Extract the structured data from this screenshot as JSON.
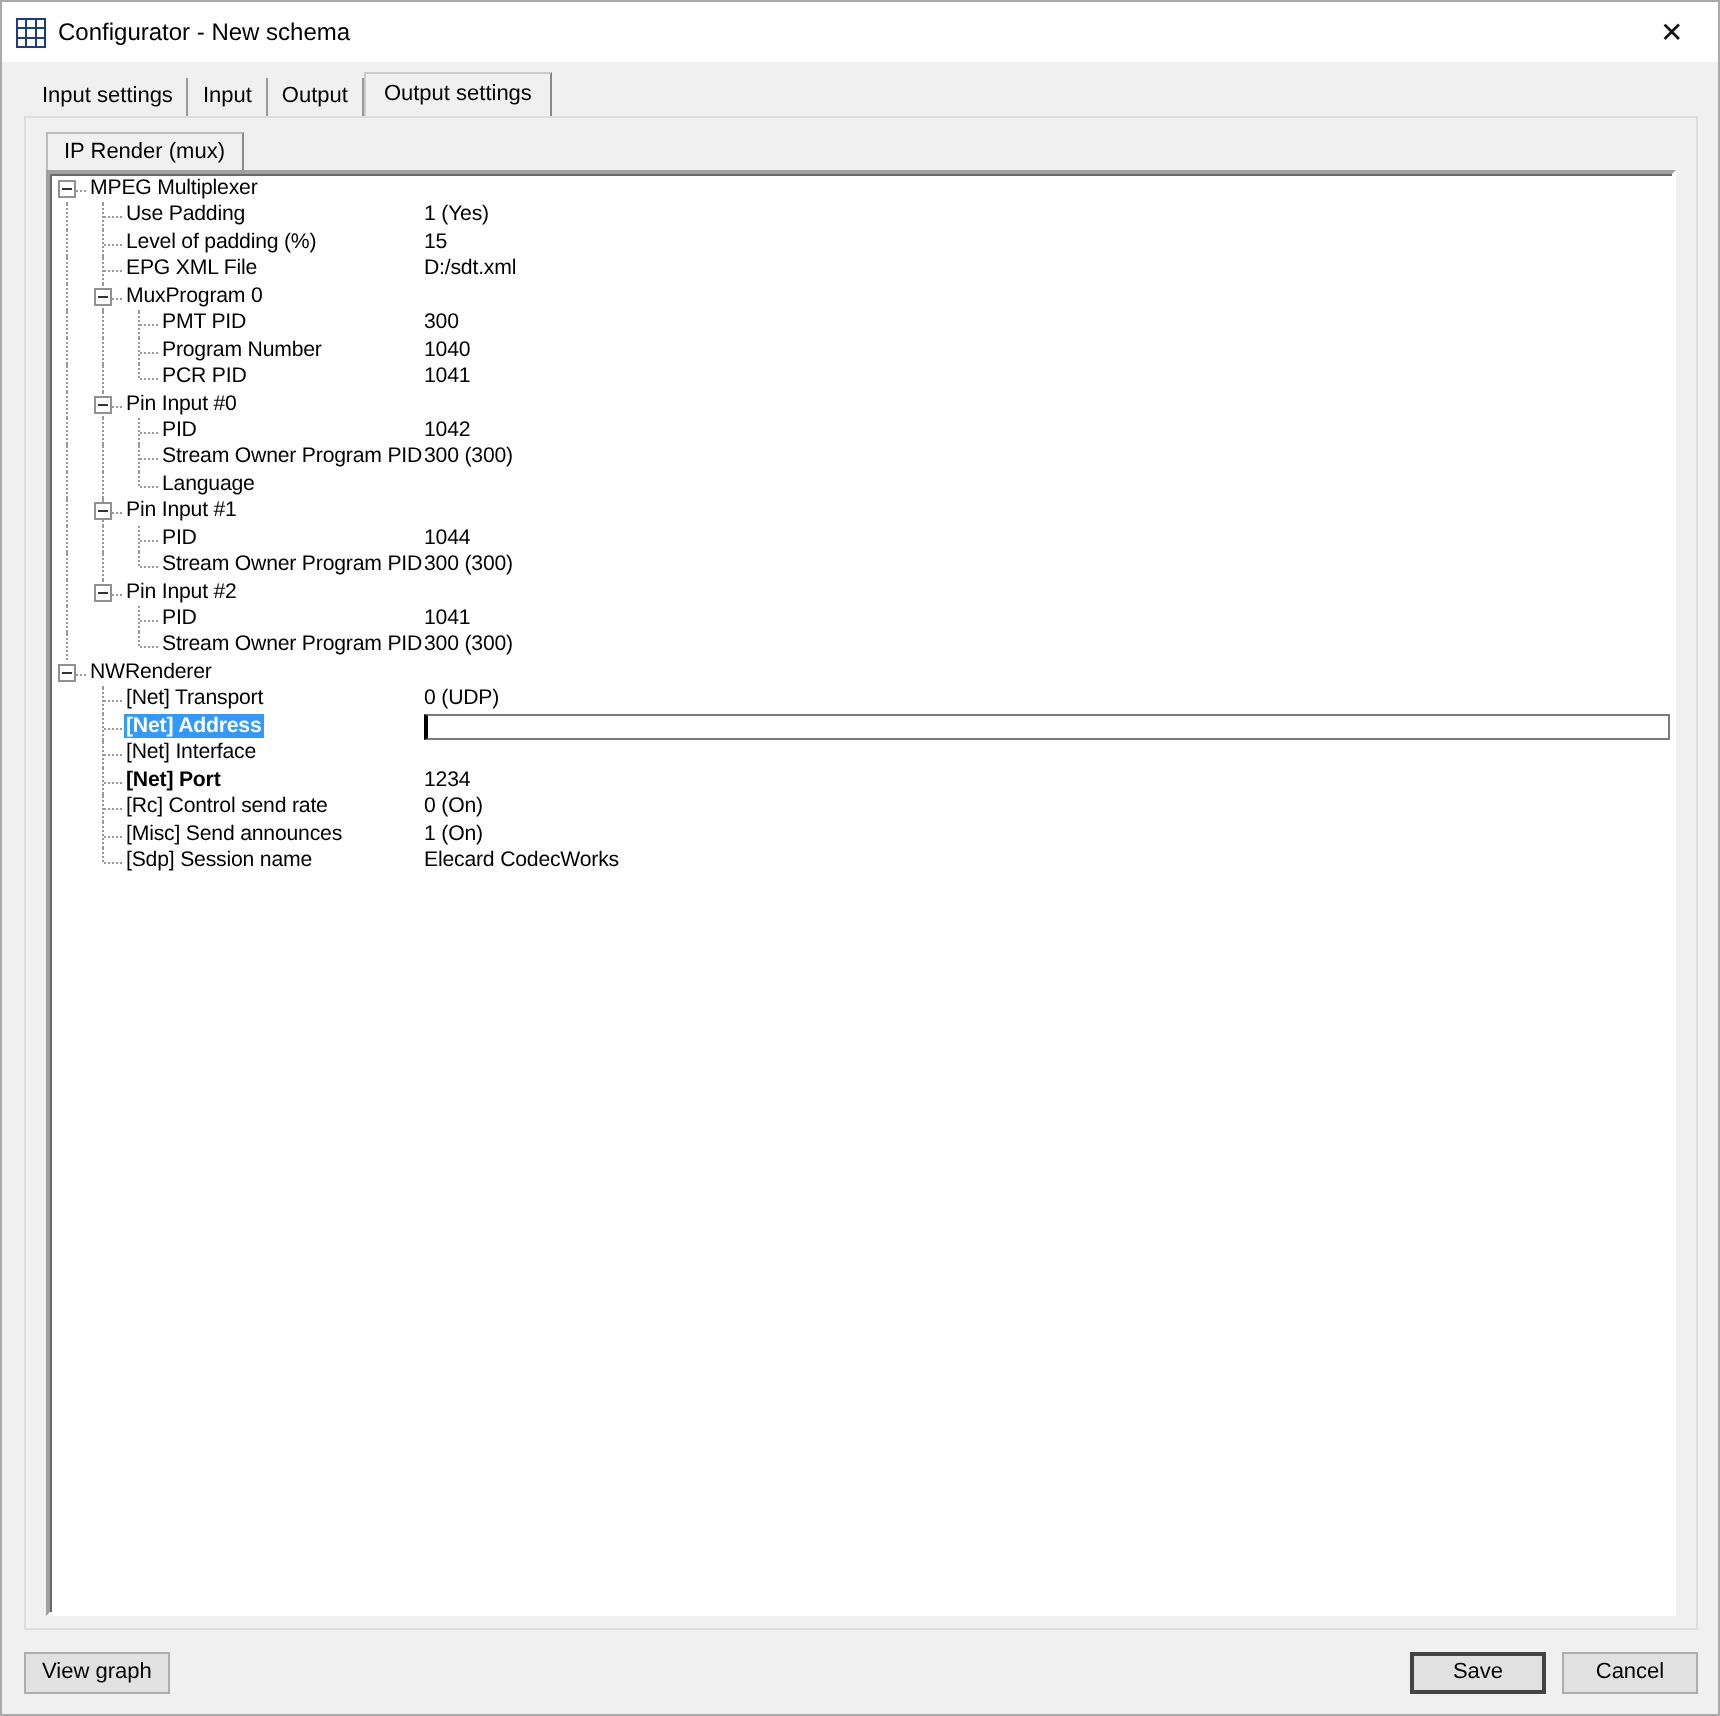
{
  "window": {
    "title": "Configurator - New schema",
    "close": "✕"
  },
  "tabs": [
    {
      "label": "Input settings",
      "selected": false
    },
    {
      "label": "Input",
      "selected": false
    },
    {
      "label": "Output",
      "selected": false
    },
    {
      "label": "Output settings",
      "selected": true
    }
  ],
  "subtabs": [
    {
      "label": "IP Render (mux)",
      "selected": true
    }
  ],
  "tree": [
    {
      "label": "MPEG Multiplexer",
      "expanded": true,
      "children": [
        {
          "label": "Use Padding",
          "value": "1 (Yes)"
        },
        {
          "label": "Level of padding (%)",
          "value": "15"
        },
        {
          "label": "EPG XML File",
          "value": "D:/sdt.xml"
        },
        {
          "label": "MuxProgram 0",
          "expanded": true,
          "children": [
            {
              "label": "PMT PID",
              "value": "300"
            },
            {
              "label": "Program Number",
              "value": "1040"
            },
            {
              "label": "PCR PID",
              "value": "1041"
            }
          ]
        },
        {
          "label": "Pin Input #0",
          "expanded": true,
          "children": [
            {
              "label": "PID",
              "value": "1042"
            },
            {
              "label": "Stream Owner Program PID",
              "value": "300 (300)"
            },
            {
              "label": "Language"
            }
          ]
        },
        {
          "label": "Pin Input #1",
          "expanded": true,
          "children": [
            {
              "label": "PID",
              "value": "1044"
            },
            {
              "label": "Stream Owner Program PID",
              "value": "300 (300)"
            }
          ]
        },
        {
          "label": "Pin Input #2",
          "expanded": true,
          "children": [
            {
              "label": "PID",
              "value": "1041"
            },
            {
              "label": "Stream Owner Program PID",
              "value": "300 (300)"
            }
          ]
        }
      ]
    },
    {
      "label": "NWRenderer",
      "expanded": true,
      "children": [
        {
          "label": "[Net] Transport",
          "value": "0 (UDP)",
          "bold": false,
          "selected": false
        },
        {
          "label": "[Net] Address",
          "bold": true,
          "selected": true,
          "editing": true
        },
        {
          "label": "[Net] Interface",
          "bold": false,
          "selected": false
        },
        {
          "label": "[Net] Port",
          "value": "1234",
          "bold": true,
          "selected": false
        },
        {
          "label": "[Rc] Control send rate",
          "value": "0 (On)",
          "bold": false,
          "selected": false
        },
        {
          "label": "[Misc] Send announces",
          "value": "1 (On)",
          "bold": false,
          "selected": false
        },
        {
          "label": "[Sdp] Session name",
          "value": "Elecard CodecWorks",
          "bold": false,
          "selected": false
        }
      ]
    }
  ],
  "buttons": {
    "left": [
      "View graph"
    ],
    "right": [
      {
        "label": "Save",
        "default": true
      },
      {
        "label": "Cancel",
        "default": false
      }
    ]
  }
}
